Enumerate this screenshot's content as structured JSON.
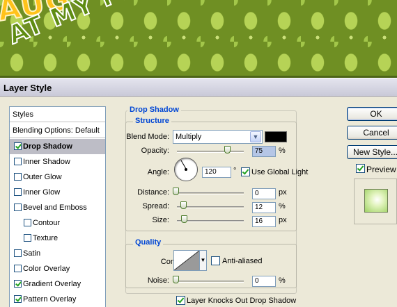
{
  "banner": {
    "line1": "AUG",
    "line2": "AT MY PLACE"
  },
  "dialog": {
    "title": "Layer Style"
  },
  "styles_list": {
    "header": "Styles",
    "blending_options": "Blending Options: Default",
    "items": [
      {
        "label": "Drop Shadow",
        "checked": true,
        "selected": true
      },
      {
        "label": "Inner Shadow",
        "checked": false
      },
      {
        "label": "Outer Glow",
        "checked": false
      },
      {
        "label": "Inner Glow",
        "checked": false
      },
      {
        "label": "Bevel and Emboss",
        "checked": false
      },
      {
        "label": "Contour",
        "checked": false,
        "sub": true
      },
      {
        "label": "Texture",
        "checked": false,
        "sub": true
      },
      {
        "label": "Satin",
        "checked": false
      },
      {
        "label": "Color Overlay",
        "checked": false
      },
      {
        "label": "Gradient Overlay",
        "checked": true
      },
      {
        "label": "Pattern Overlay",
        "checked": true
      }
    ]
  },
  "drop_shadow": {
    "section_title": "Drop Shadow",
    "structure": {
      "title": "Structure",
      "blend_mode_label": "Blend Mode:",
      "blend_mode_value": "Multiply",
      "shadow_color": "#000000",
      "opacity_label": "Opacity:",
      "opacity_value": "75",
      "opacity_unit": "%",
      "opacity_fraction": 0.75,
      "angle_label": "Angle:",
      "angle_value": "120",
      "angle_unit": "°",
      "use_global_light_label": "Use Global Light",
      "use_global_light": true,
      "distance_label": "Distance:",
      "distance_value": "0",
      "distance_unit": "px",
      "spread_label": "Spread:",
      "spread_value": "12",
      "spread_unit": "%",
      "size_label": "Size:",
      "size_value": "16",
      "size_unit": "px"
    },
    "quality": {
      "title": "Quality",
      "contour_label": "Contour:",
      "anti_aliased_label": "Anti-aliased",
      "anti_aliased": false,
      "noise_label": "Noise:",
      "noise_value": "0",
      "noise_unit": "%"
    },
    "knockout_label": "Layer Knocks Out Drop Shadow",
    "knockout": true
  },
  "buttons": {
    "ok": "OK",
    "cancel": "Cancel",
    "new_style": "New Style...",
    "preview_label": "Preview",
    "preview_checked": true
  }
}
